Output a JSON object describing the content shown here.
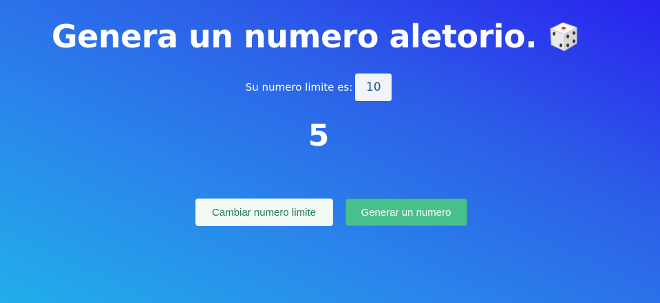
{
  "header": {
    "title": "Genera un numero aletorio.",
    "icon": "dice-icon"
  },
  "limit": {
    "label": "Su numero limite es:",
    "value": "10"
  },
  "result": {
    "value": "5"
  },
  "buttons": {
    "change_limit_label": "Cambiar numero limite",
    "generate_label": "Generar un numero"
  },
  "colors": {
    "background_start": "#22aeea",
    "background_end": "#2a22ee",
    "primary_button": "#48c08c",
    "secondary_button_text": "#257a4b"
  }
}
